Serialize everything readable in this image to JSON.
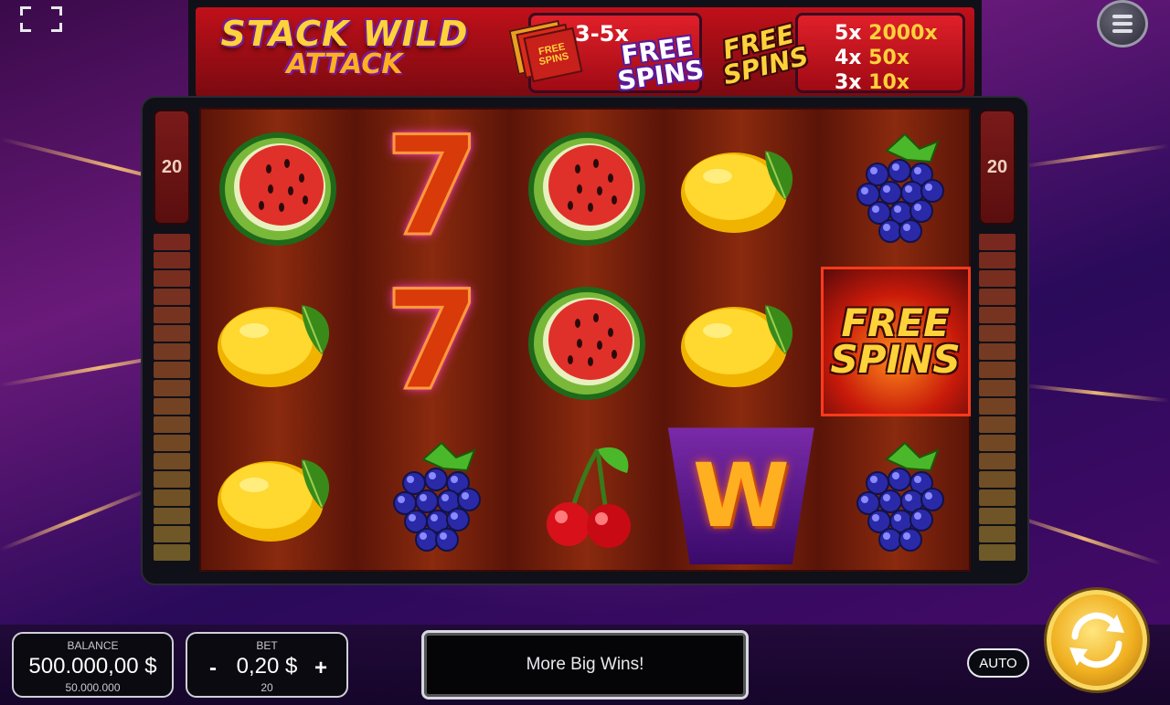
{
  "header": {
    "logo_line1": "STACK WILD",
    "logo_line2": "ATTACK",
    "promo_multiplier": "3-5x",
    "promo_card_text": "FREE SPINS",
    "promo_free_spins": "FREE SPINS",
    "scatter_badge": "FREE SPINS",
    "paytable": [
      {
        "count": "5x",
        "pay": "2000x"
      },
      {
        "count": "4x",
        "pay": "50x"
      },
      {
        "count": "3x",
        "pay": "10x"
      }
    ]
  },
  "reels": {
    "left_lines": "20",
    "right_lines": "20",
    "grid": [
      [
        "watermelon",
        "seven",
        "watermelon",
        "lemon",
        "grapes"
      ],
      [
        "lemon",
        "seven",
        "watermelon",
        "lemon",
        "free-spins"
      ],
      [
        "lemon",
        "grapes",
        "cherries",
        "wild",
        "grapes"
      ]
    ],
    "free_spins_symbol_text": "FREE SPINS",
    "wild_symbol_text": "W",
    "seven_symbol_text": "7"
  },
  "balance": {
    "caption": "BALANCE",
    "amount": "500.000,00 $",
    "sub": "50.000.000"
  },
  "bet": {
    "caption": "BET",
    "amount": "0,20 $",
    "sub": "20",
    "minus": "-",
    "plus": "+"
  },
  "message": "More Big Wins!",
  "controls": {
    "auto_label": "AUTO"
  },
  "colors": {
    "accent_gold": "#ffd23a",
    "reel_red": "#8a2a0e",
    "frame": "#101018"
  }
}
